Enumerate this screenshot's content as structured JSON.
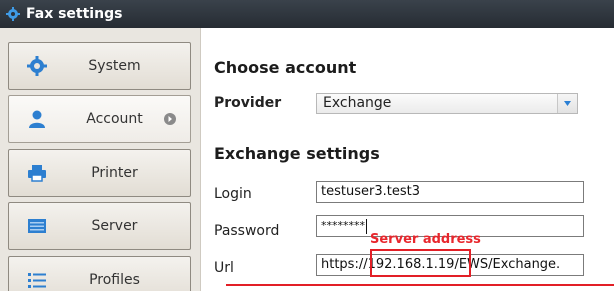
{
  "window": {
    "title": "Fax settings",
    "icon": "gear-icon"
  },
  "sidebar": {
    "items": [
      {
        "label": "System",
        "icon": "gear-icon",
        "active": false
      },
      {
        "label": "Account",
        "icon": "user-icon",
        "active": true
      },
      {
        "label": "Printer",
        "icon": "printer-icon",
        "active": false
      },
      {
        "label": "Server",
        "icon": "server-icon",
        "active": false
      },
      {
        "label": "Profiles",
        "icon": "list-icon",
        "active": false
      }
    ]
  },
  "main": {
    "choose_account_title": "Choose account",
    "provider_label": "Provider",
    "provider_value": "Exchange",
    "exchange_title": "Exchange settings",
    "login_label": "Login",
    "login_value": "testuser3.test3",
    "password_label": "Password",
    "password_value": "********",
    "url_label": "Url",
    "url_prefix": "https://",
    "url_host": "192.168.1.19",
    "url_suffix": "/EWS/Exchange."
  },
  "annotation": {
    "text": "Server address",
    "color": "#e21f26"
  },
  "colors": {
    "titlebar": "#2f363d",
    "accent_blue": "#2a7fd4"
  }
}
